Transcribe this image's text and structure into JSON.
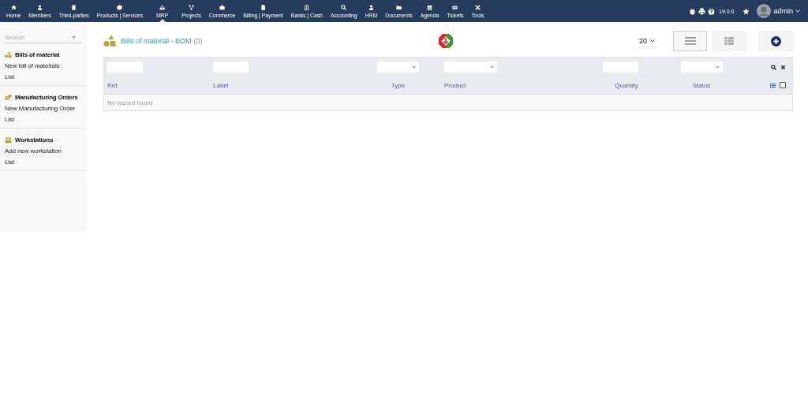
{
  "topbar": {
    "menu": [
      {
        "label": "Home",
        "selected": false
      },
      {
        "label": "Members",
        "selected": false
      },
      {
        "label": "Third-parties",
        "selected": false
      },
      {
        "label": "Products | Services",
        "selected": false
      },
      {
        "label": "MRP",
        "selected": true
      },
      {
        "label": "Projects",
        "selected": false
      },
      {
        "label": "Commerce",
        "selected": false
      },
      {
        "label": "Billing | Payment",
        "selected": false
      },
      {
        "label": "Banks | Cash",
        "selected": false
      },
      {
        "label": "Accounting",
        "selected": false
      },
      {
        "label": "HRM",
        "selected": false
      },
      {
        "label": "Documents",
        "selected": false
      },
      {
        "label": "Agenda",
        "selected": false
      },
      {
        "label": "Tickets",
        "selected": false
      },
      {
        "label": "Tools",
        "selected": false
      }
    ],
    "version": "19.0.0",
    "user": "admin"
  },
  "sidebar": {
    "search": {
      "placeholder": "Search"
    },
    "sections": [
      {
        "title": "Bills of material",
        "items": [
          "New bill of materials",
          "List"
        ]
      },
      {
        "title": "Manufacturing Orders",
        "items": [
          "New Manufacturing Order",
          "List"
        ]
      },
      {
        "title": "Workstations",
        "items": [
          "Add new workstation",
          "List"
        ]
      }
    ]
  },
  "header": {
    "title": "Bills of material - BOM",
    "count": "(0)",
    "page_size": "20"
  },
  "table": {
    "columns": [
      {
        "label": "Ref.",
        "kind": "text"
      },
      {
        "label": "Label",
        "kind": "text"
      },
      {
        "label": "Type",
        "kind": "select"
      },
      {
        "label": "Product",
        "kind": "select"
      },
      {
        "label": "Quantity",
        "kind": "text"
      },
      {
        "label": "Status",
        "kind": "select"
      }
    ],
    "empty_message": "No record found",
    "select_all_checked": false
  }
}
